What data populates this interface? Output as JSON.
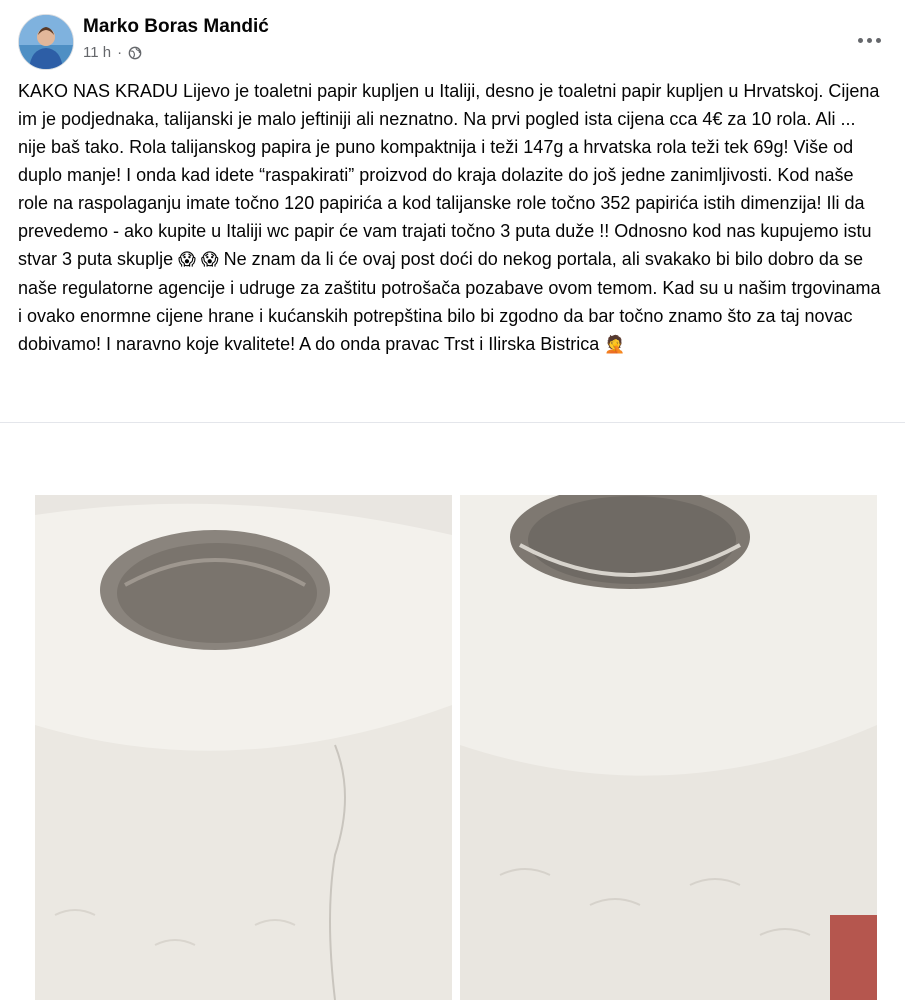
{
  "post": {
    "author": "Marko Boras Mandić",
    "time": "11 h",
    "separator": "·",
    "audience_icon": "globe-icon",
    "more_icon": "more-options-icon",
    "text_parts": [
      "KAKO NAS KRADU Lijevo je toaletni papir kupljen u Italiji, desno je toaletni papir kupljen u Hrvatskoj. Cijena im je podjednaka, talijanski je malo jeftiniji ali neznatno. Na prvi pogled ista cijena cca 4€ za 10 rola. Ali ... nije baš tako. Rola talijanskog papira je puno kompaktnija i teži 147g a hrvatska rola teži tek 69g! Više od duplo manje! I onda kad idete “raspakirati” proizvod do kraja dolazite do još jedne zanimljivosti.  Kod naše role na raspolaganju imate točno 120 papirića a kod talijanske role točno 352 papirića istih dimenzija! Ili da prevedemo - ako kupite u Italiji wc papir će vam trajati točno 3 puta duže !! Odnosno kod nas kupujemo istu stvar 3 puta skuplje ",
      " Ne znam da li će ovaj post doći do nekog portala, ali svakako bi bilo dobro da se naše regulatorne agencije i udruge za zaštitu potrošača pozabave ovom temom. Kad su u našim trgovinama i ovako enormne cijene hrane i kućanskih potrepština bilo bi zgodno da bar točno znamo što za taj novac dobivamo! I naravno koje kvalitete! A do onda pravac Trst i Ilirska Bistrica "
    ],
    "emojis": [
      "😱",
      "😱",
      "🤦"
    ]
  },
  "photos": [
    {
      "name": "italian-toilet-paper-roll-photo"
    },
    {
      "name": "croatian-toilet-paper-roll-photo"
    }
  ],
  "colors": {
    "text": "#050505",
    "secondary": "#65676b",
    "divider": "#e4e6eb",
    "paper": "#f4f2ee",
    "core": "#7b7670"
  }
}
